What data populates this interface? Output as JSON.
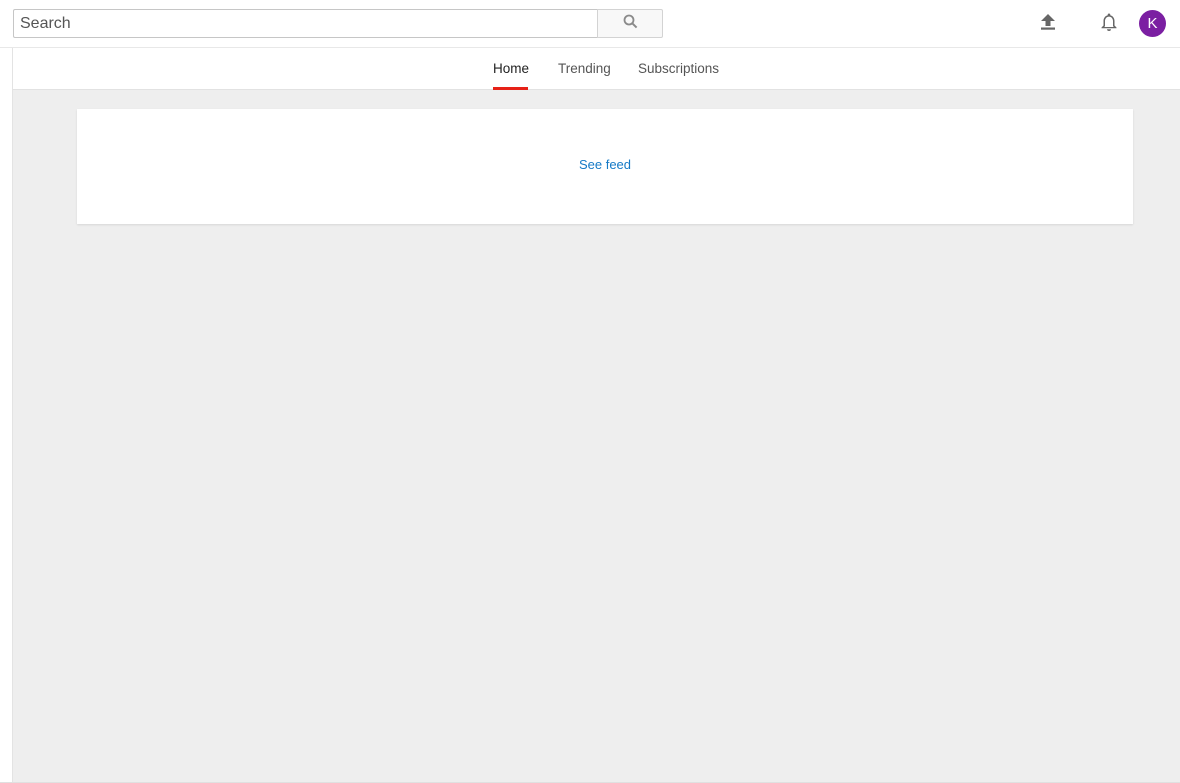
{
  "masthead": {
    "search": {
      "placeholder": "Search",
      "button_icon": "search-icon"
    },
    "upload_icon": "upload-icon",
    "notifications_icon": "bell-icon",
    "avatar_letter": "K",
    "avatar_color": "#7b1fa2"
  },
  "tabs": [
    {
      "label": "Home",
      "active": true
    },
    {
      "label": "Trending",
      "active": false
    },
    {
      "label": "Subscriptions",
      "active": false
    }
  ],
  "feed": {
    "link_label": "See feed"
  },
  "colors": {
    "accent_red": "#e62117",
    "link_blue": "#167ac6",
    "content_bg": "#eeeeee"
  }
}
